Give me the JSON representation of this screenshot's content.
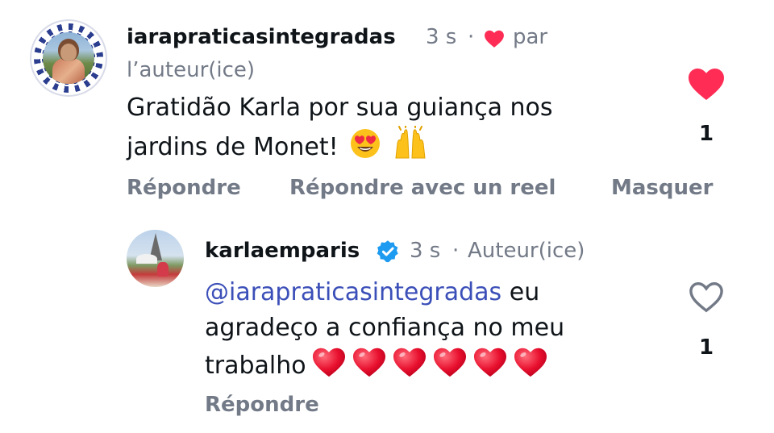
{
  "colors": {
    "like_red": "#ff2d55",
    "mention_blue": "#3b4fb8",
    "muted_gray": "#737a87",
    "verified_blue": "#1d9bf0"
  },
  "comments": [
    {
      "username": "iarapraticasintegradas",
      "time": "3 s",
      "separator": "·",
      "liked_by_author_prefix": "par",
      "liked_by_author_suffix": "l’auteur(ice)",
      "text": "Gratidão Karla por sua guiança nos jardins de Monet!",
      "text_line1": "Gratidão Karla por sua guiança nos",
      "text_line2": "jardins de Monet!",
      "emojis": [
        "heart-eyes-emoji",
        "raising-hands-emoji"
      ],
      "actions": [
        "Répondre",
        "Répondre avec un reel",
        "Masquer"
      ],
      "like_count": "1",
      "liked": true
    },
    {
      "username": "karlaemparis",
      "verified": true,
      "time": "3 s",
      "separator": "·",
      "author_tag": "Auteur(ice)",
      "mention": "@iarapraticasintegradas",
      "text_after_mention": " eu",
      "text_line2": "agradeço a confiança no meu",
      "text_line3": "trabalho",
      "emojis": [
        "red-heart-emoji",
        "red-heart-emoji",
        "red-heart-emoji",
        "red-heart-emoji",
        "red-heart-emoji",
        "red-heart-emoji"
      ],
      "actions": [
        "Répondre"
      ],
      "like_count": "1",
      "liked": false
    }
  ]
}
